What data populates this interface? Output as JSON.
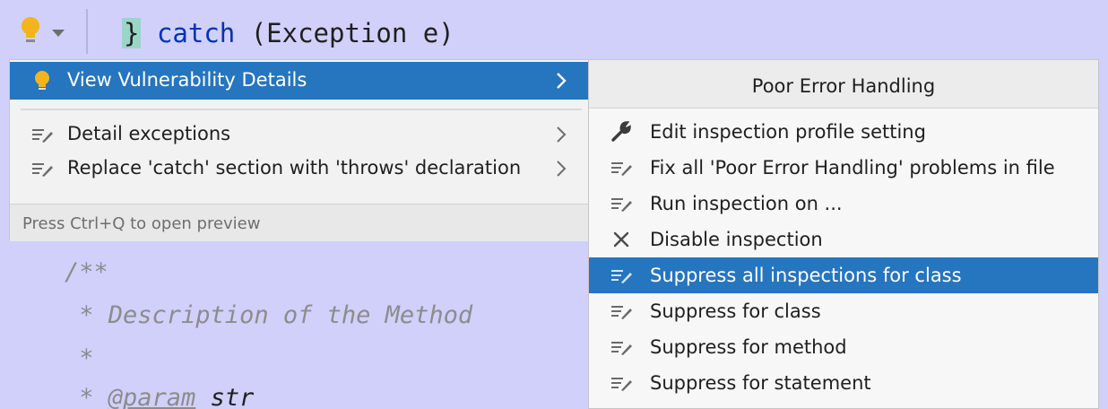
{
  "editor": {
    "code_line": {
      "brace": "}",
      "keyword": "catch",
      "rest": " (Exception e)"
    },
    "doc_lines": [
      "/**",
      " * Description of the Method",
      " *",
      " * "
    ],
    "doc_param_tag": "@param",
    "doc_param_name": " str"
  },
  "quick_fix_menu": {
    "items": [
      {
        "label": "View Vulnerability Details",
        "icon": "lightbulb-icon",
        "has_submenu": true,
        "selected": true
      },
      {
        "label": "Detail exceptions",
        "icon": "quick-fix-icon",
        "has_submenu": true,
        "selected": false
      },
      {
        "label": "Replace 'catch' section with 'throws' declaration",
        "icon": "quick-fix-icon",
        "has_submenu": true,
        "selected": false
      }
    ],
    "footer": "Press Ctrl+Q to open preview"
  },
  "submenu": {
    "title": "Poor Error Handling",
    "items": [
      {
        "label": "Edit inspection profile setting",
        "icon": "wrench-icon",
        "selected": false
      },
      {
        "label": "Fix all 'Poor Error Handling' problems in file",
        "icon": "quick-fix-icon",
        "selected": false
      },
      {
        "label": "Run inspection on ...",
        "icon": "quick-fix-icon",
        "selected": false
      },
      {
        "label": "Disable inspection",
        "icon": "close-icon",
        "selected": false
      },
      {
        "label": "Suppress all inspections for class",
        "icon": "quick-fix-icon",
        "selected": true
      },
      {
        "label": "Suppress for class",
        "icon": "quick-fix-icon",
        "selected": false
      },
      {
        "label": "Suppress for method",
        "icon": "quick-fix-icon",
        "selected": false
      },
      {
        "label": "Suppress for statement",
        "icon": "quick-fix-icon",
        "selected": false
      }
    ]
  },
  "colors": {
    "selection": "#2675bf",
    "editor_bg": "#d0d0fb",
    "bulb": "#f5b31c",
    "keyword": "#0033b3"
  }
}
